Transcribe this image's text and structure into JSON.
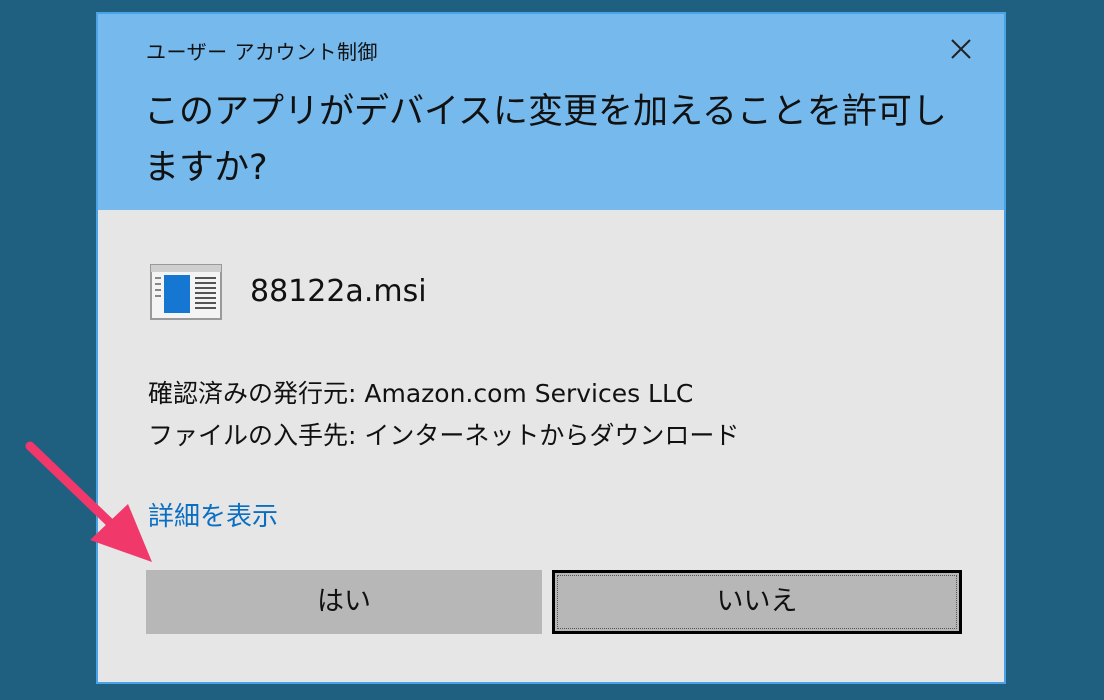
{
  "dialog": {
    "title": "ユーザー アカウント制御",
    "question": "このアプリがデバイスに変更を加えることを許可しますか?",
    "app_name": "88122a.msi",
    "publisher_line": "確認済みの発行元: Amazon.com Services LLC",
    "origin_line": "ファイルの入手先: インターネットからダウンロード",
    "details_link": "詳細を表示",
    "yes_label": "はい",
    "no_label": "いいえ"
  },
  "colors": {
    "desktop": "#1f5f80",
    "header": "#76b9ec",
    "body": "#e6e6e6",
    "link": "#0a6fc2",
    "button": "#b7b7b7",
    "annotation_arrow": "#f0386b"
  },
  "icons": {
    "close": "close-icon",
    "app": "installer-window-icon",
    "annotation": "pointer-arrow-icon"
  }
}
